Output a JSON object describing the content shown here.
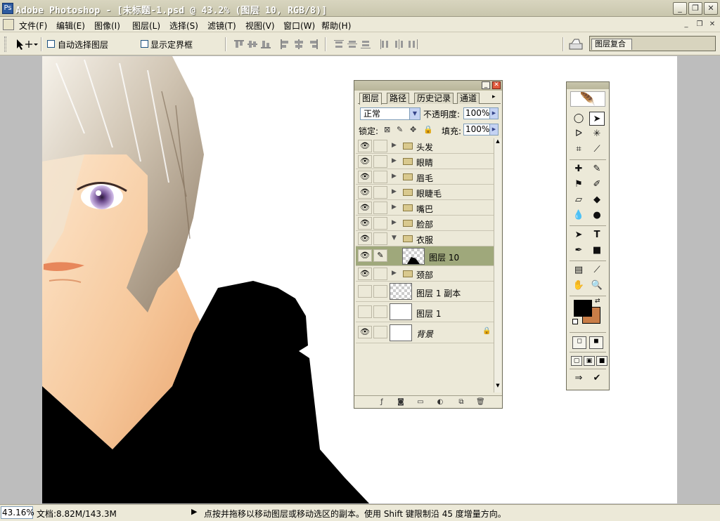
{
  "app": {
    "title": "Adobe Photoshop - [未标题-1.psd @ 43.2% (图层 10, RGB/8)]"
  },
  "window_controls": [
    "_",
    "❐",
    "✕"
  ],
  "doc_controls": [
    "_",
    "❐",
    "✕"
  ],
  "menu": [
    "文件(F)",
    "编辑(E)",
    "图像(I)",
    "图层(L)",
    "选择(S)",
    "滤镜(T)",
    "视图(V)",
    "窗口(W)",
    "帮助(H)"
  ],
  "options_bar": {
    "auto_select_label": "自动选择图层",
    "show_bounds_label": "显示定界框",
    "layer_comps_tab": "图层复合"
  },
  "layers_panel": {
    "tabs": [
      "图层",
      "路径",
      "历史记录",
      "通道"
    ],
    "blend_mode": "正常",
    "opacity_label": "不透明度:",
    "opacity_value": "100%",
    "lock_label": "锁定:",
    "fill_label": "填充:",
    "fill_value": "100%",
    "layers": [
      {
        "name": "头发",
        "type": "group",
        "visible": true,
        "expanded": false
      },
      {
        "name": "眼睛",
        "type": "group",
        "visible": true,
        "expanded": false
      },
      {
        "name": "眉毛",
        "type": "group",
        "visible": true,
        "expanded": false
      },
      {
        "name": "眼睫毛",
        "type": "group",
        "visible": true,
        "expanded": false
      },
      {
        "name": "嘴巴",
        "type": "group",
        "visible": true,
        "expanded": false
      },
      {
        "name": "脸部",
        "type": "group",
        "visible": true,
        "expanded": false
      },
      {
        "name": "衣服",
        "type": "group",
        "visible": true,
        "expanded": true
      },
      {
        "name": "图层 10",
        "type": "layer",
        "visible": true,
        "selected": true
      },
      {
        "name": "颈部",
        "type": "group",
        "visible": true,
        "expanded": false
      },
      {
        "name": "图层 1 副本",
        "type": "layer",
        "visible": false
      },
      {
        "name": "图层 1",
        "type": "layer",
        "visible": false
      },
      {
        "name": "背景",
        "type": "background",
        "visible": true,
        "locked": true
      }
    ]
  },
  "tools_panel": {
    "foreground_color": "#000000",
    "background_color": "#c97d47",
    "tools": [
      "marquee",
      "move",
      "lasso",
      "magic-wand",
      "crop",
      "slice",
      "healing",
      "brush",
      "stamp",
      "history-brush",
      "eraser",
      "bucket",
      "dodge",
      "burn",
      "path-select",
      "type",
      "pen",
      "shape",
      "notes",
      "eyedropper",
      "hand",
      "zoom"
    ]
  },
  "status": {
    "zoom": "43.16%",
    "doc_info": "文档:8.82M/143.3M",
    "message": "点按并拖移以移动图层或移动选区的副本。使用 Shift 键限制沿 45 度增量方向。"
  },
  "colors": {
    "chrome": "#ece9d8",
    "workspace": "#bdbdbd",
    "selected_layer": "#9fa87b"
  }
}
